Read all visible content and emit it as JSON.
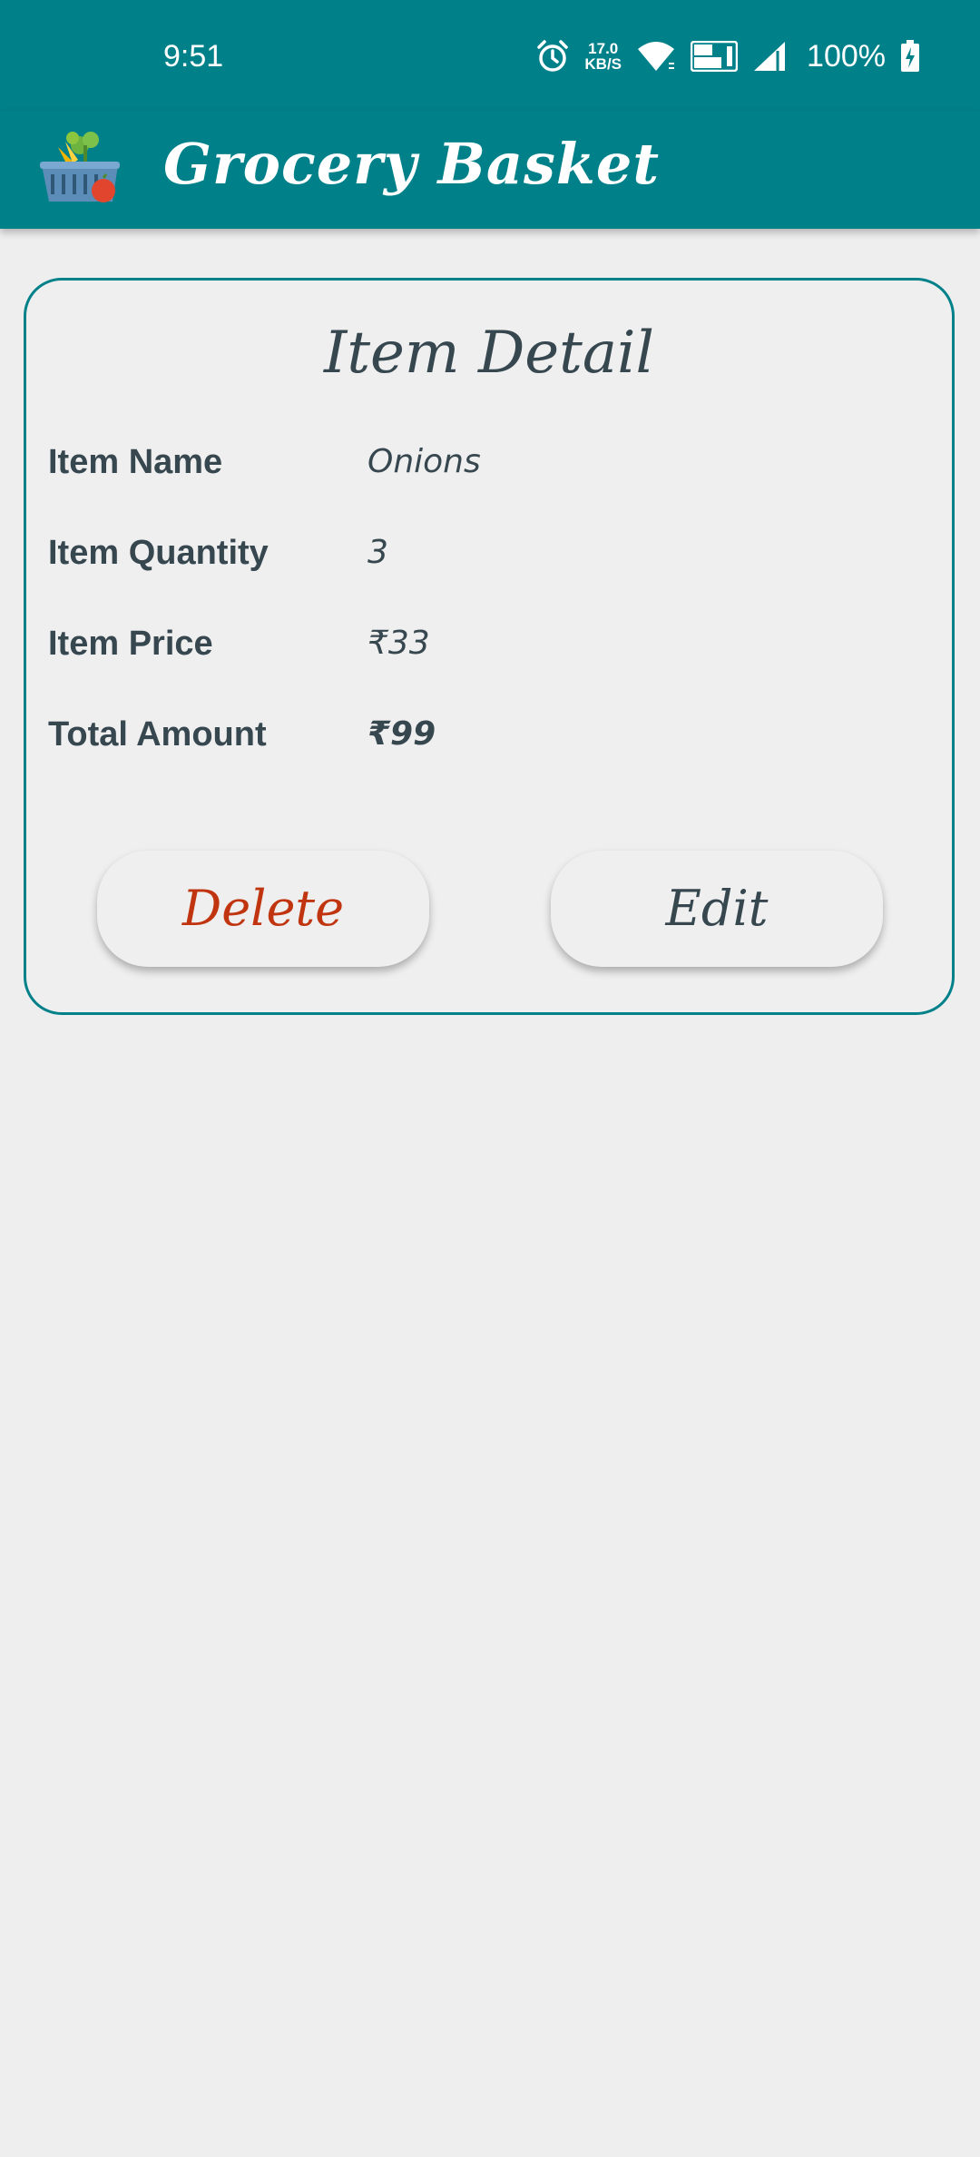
{
  "status_bar": {
    "time": "9:51",
    "net_speed_value": "17.0",
    "net_speed_unit": "KB/S",
    "battery_percent": "100%",
    "icons": [
      "alarm-icon",
      "wifi-icon",
      "vowifi-icon",
      "cell-signal-icon",
      "battery-charging-icon"
    ]
  },
  "app_bar": {
    "title": "Grocery Basket",
    "logo_icon": "grocery-basket-logo-icon"
  },
  "card": {
    "title": "Item Detail",
    "rows": [
      {
        "label": "Item Name",
        "value": "Onions"
      },
      {
        "label": "Item Quantity",
        "value": "3"
      },
      {
        "label": "Item Price",
        "value": "₹33"
      },
      {
        "label": "Total Amount",
        "value": "₹99"
      }
    ],
    "delete_label": "Delete",
    "edit_label": "Edit"
  },
  "colors": {
    "primary": "#00818a",
    "background": "#eeeeee",
    "text": "#37474f",
    "delete_text": "#c0350f"
  }
}
